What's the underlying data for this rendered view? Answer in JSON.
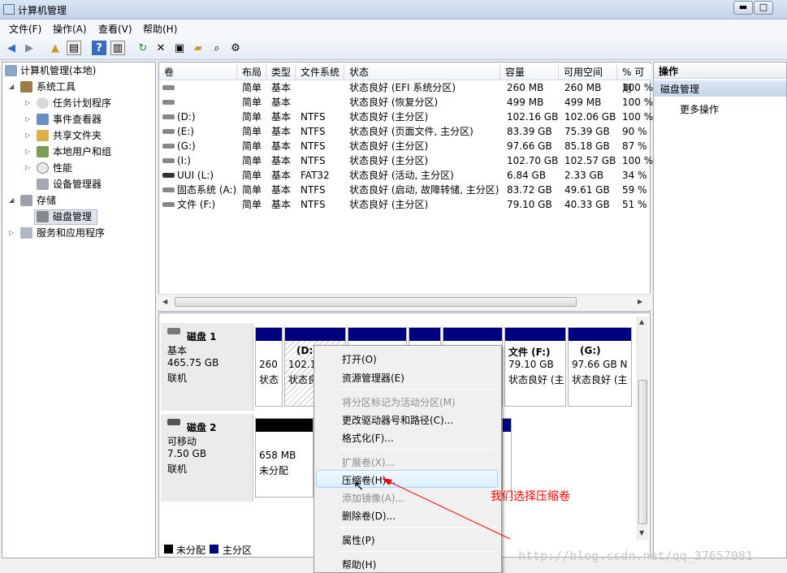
{
  "window": {
    "title": "计算机管理",
    "min": "▬",
    "max": "□",
    "close": "✕"
  },
  "menubar": [
    "文件(F)",
    "操作(A)",
    "查看(V)",
    "帮助(H)"
  ],
  "toolbar_icons": [
    "back-arrow-icon",
    "forward-arrow-icon",
    "up-folder-icon",
    "show-tree-icon",
    "help-icon",
    "properties-icon",
    "refresh-icon",
    "delete-icon",
    "connect-icon",
    "open-folder-icon",
    "search-icon",
    "settings-icon"
  ],
  "tree": {
    "root": "计算机管理(本地)",
    "system_tools": "系统工具",
    "task_scheduler": "任务计划程序",
    "event_viewer": "事件查看器",
    "shared_folders": "共享文件夹",
    "local_users": "本地用户和组",
    "performance": "性能",
    "device_manager": "设备管理器",
    "storage": "存储",
    "disk_management": "磁盘管理",
    "services": "服务和应用程序"
  },
  "volume_table": {
    "headers": [
      "卷",
      "布局",
      "类型",
      "文件系统",
      "状态",
      "容量",
      "可用空间",
      "% 可用"
    ],
    "rows": [
      {
        "vol": "",
        "layout": "简单",
        "type": "基本",
        "fs": "",
        "status": "状态良好 (EFI 系统分区)",
        "cap": "260 MB",
        "free": "260 MB",
        "pct": "100 %"
      },
      {
        "vol": "",
        "layout": "简单",
        "type": "基本",
        "fs": "",
        "status": "状态良好 (恢复分区)",
        "cap": "499 MB",
        "free": "499 MB",
        "pct": "100 %"
      },
      {
        "vol": "(D:)",
        "layout": "简单",
        "type": "基本",
        "fs": "NTFS",
        "status": "状态良好 (主分区)",
        "cap": "102.16 GB",
        "free": "102.06 GB",
        "pct": "100 %"
      },
      {
        "vol": "(E:)",
        "layout": "简单",
        "type": "基本",
        "fs": "NTFS",
        "status": "状态良好 (页面文件, 主分区)",
        "cap": "83.39 GB",
        "free": "75.39 GB",
        "pct": "90 %"
      },
      {
        "vol": "(G:)",
        "layout": "简单",
        "type": "基本",
        "fs": "NTFS",
        "status": "状态良好 (主分区)",
        "cap": "97.66 GB",
        "free": "85.18 GB",
        "pct": "87 %"
      },
      {
        "vol": "(I:)",
        "layout": "简单",
        "type": "基本",
        "fs": "NTFS",
        "status": "状态良好 (主分区)",
        "cap": "102.70 GB",
        "free": "102.57 GB",
        "pct": "100 %"
      },
      {
        "vol": "UUI (L:)",
        "layout": "简单",
        "type": "基本",
        "fs": "FAT32",
        "status": "状态良好 (活动, 主分区)",
        "cap": "6.84 GB",
        "free": "2.33 GB",
        "pct": "34 %"
      },
      {
        "vol": "固态系统 (A:)",
        "layout": "简单",
        "type": "基本",
        "fs": "NTFS",
        "status": "状态良好 (启动, 故障转储, 主分区)",
        "cap": "83.72 GB",
        "free": "49.61 GB",
        "pct": "59 %"
      },
      {
        "vol": "文件 (F:)",
        "layout": "简单",
        "type": "基本",
        "fs": "NTFS",
        "status": "状态良好 (主分区)",
        "cap": "79.10 GB",
        "free": "40.33 GB",
        "pct": "51 %"
      }
    ]
  },
  "disk1": {
    "name": "磁盘 1",
    "type": "基本",
    "size": "465.75 GB",
    "status": "联机",
    "p1": {
      "l1": "260",
      "l2": "状态"
    },
    "p2": {
      "l0": "(D:)",
      "l1": "102.1",
      "l2": "状态良"
    },
    "p3": {
      "l0": "文件  (F:)",
      "l1": "79.10 GB",
      "l2": "状态良好 (主"
    },
    "p4": {
      "l0": "(G:)",
      "l1": "97.66 GB N",
      "l2": "状态良好 (主"
    }
  },
  "disk2": {
    "name": "磁盘 2",
    "type": "可移动",
    "size": "7.50 GB",
    "status": "联机",
    "p1": {
      "l1": "658 MB",
      "l2": "未分配"
    }
  },
  "legend": {
    "unallocated": "未分配",
    "primary": "主分区"
  },
  "actions": {
    "header": "操作",
    "section": "磁盘管理",
    "more": "更多操作"
  },
  "context_menu": {
    "open": "打开(O)",
    "explorer": "资源管理器(E)",
    "mark_active": "将分区标记为活动分区(M)",
    "change_letter": "更改驱动器号和路径(C)...",
    "format": "格式化(F)...",
    "extend": "扩展卷(X)...",
    "shrink": "压缩卷(H)...",
    "mirror": "添加镜像(A)...",
    "delete": "删除卷(D)...",
    "properties": "属性(P)",
    "help": "帮助(H)"
  },
  "annotation": "我们选择压缩卷",
  "watermark": "http://blog.csdn.net/qq_37657081",
  "colors": {
    "primary_partition": "#00007f",
    "unallocated": "#000000",
    "annotation": "#ff0000"
  }
}
